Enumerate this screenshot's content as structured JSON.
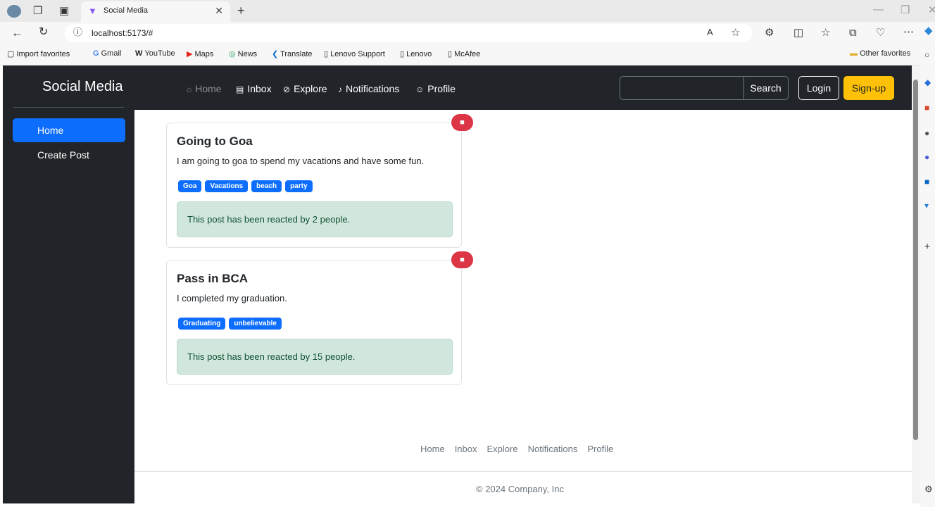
{
  "browser": {
    "tab_title": "Social Media",
    "url": "localhost:5173/#",
    "favorites": [
      {
        "label": "Import favorites",
        "icon": "import-icon"
      },
      {
        "label": "Gmail",
        "icon": "google-icon"
      },
      {
        "label": "YouTube",
        "icon": "w-icon"
      },
      {
        "label": "Maps",
        "icon": "youtube-icon"
      },
      {
        "label": "News",
        "icon": "news-icon"
      },
      {
        "label": "Translate",
        "icon": "translate-icon"
      },
      {
        "label": "Lenovo Support",
        "icon": "page-icon"
      },
      {
        "label": "Lenovo",
        "icon": "page-icon"
      },
      {
        "label": "McAfee",
        "icon": "page-icon"
      }
    ],
    "other_favorites": "Other favorites"
  },
  "nav": {
    "brand": "Social Media",
    "links": [
      {
        "label": "Home",
        "icon": "home-icon",
        "active": true
      },
      {
        "label": "Inbox",
        "icon": "inbox-icon",
        "active": false
      },
      {
        "label": "Explore",
        "icon": "compass-icon",
        "active": false
      },
      {
        "label": "Notifications",
        "icon": "bell-icon",
        "active": false
      },
      {
        "label": "Profile",
        "icon": "user-circle-icon",
        "active": false
      }
    ],
    "search_value": "",
    "search_label": "Search",
    "login_label": "Login",
    "signup_label": "Sign-up"
  },
  "sidebar": {
    "items": [
      {
        "label": "Home",
        "active": true
      },
      {
        "label": "Create Post",
        "active": false
      }
    ]
  },
  "posts": [
    {
      "title": "Going to Goa",
      "body": "I am going to goa to spend my vacations and have some fun.",
      "tags": [
        "Goa",
        "Vacations",
        "beach",
        "party"
      ],
      "reactions": "This post has been reacted by 2 people."
    },
    {
      "title": "Pass in BCA",
      "body": "I completed my graduation.",
      "tags": [
        "Graduating",
        "unbelievable"
      ],
      "reactions": "This post has been reacted by 15 people."
    }
  ],
  "footer": {
    "links": [
      "Home",
      "Inbox",
      "Explore",
      "Notifications",
      "Profile"
    ],
    "copyright": "© 2024 Company, Inc"
  },
  "colors": {
    "primary": "#0d6efd",
    "dark": "#212529",
    "warning": "#ffc107",
    "danger": "#dc3545",
    "success_bg": "#d1e7dd"
  }
}
